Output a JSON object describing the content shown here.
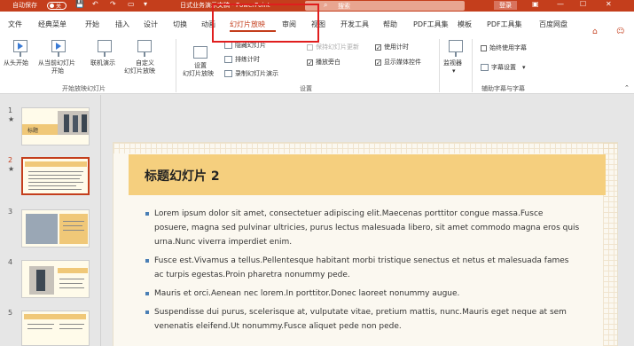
{
  "titlebar": {
    "autosave_label": "自动保存",
    "autosave_state": "关",
    "document_title": "日式业务演示文稿 - PowerPoint",
    "search_placeholder": "搜索",
    "login_label": "登录"
  },
  "tabs": [
    "文件",
    "经典菜单",
    "开始",
    "插入",
    "设计",
    "切换",
    "动画",
    "幻灯片放映",
    "审阅",
    "视图",
    "开发工具",
    "帮助",
    "PDF工具集",
    "模板",
    "PDF工具集",
    "百度网盘"
  ],
  "active_tab": "幻灯片放映",
  "ribbon": {
    "from_start": "从头开始",
    "from_current_l1": "从当前幻灯片",
    "from_current_l2": "开始",
    "online_present_l1": "联机演示",
    "online_present_l2": "",
    "custom_show_l1": "自定义",
    "custom_show_l2": "幻灯片放映",
    "group_start": "开始放映幻灯片",
    "setup_show_l1": "设置",
    "setup_show_l2": "幻灯片放映",
    "hide_slide": "隐藏幻灯片",
    "rehearse": "排练计时",
    "record": "录制幻灯片演示",
    "play_narrations": "播放旁白",
    "use_timings": "使用计时",
    "keep_updated": "保持幻灯片更新",
    "show_media_controls": "显示媒体控件",
    "group_setup": "设置",
    "monitor_l1": "监视器",
    "always_subtitles": "始终使用字幕",
    "subtitle_settings": "字幕设置",
    "group_captions": "辅助字幕与字幕"
  },
  "thumbnails": [
    {
      "num": "1",
      "star": "★"
    },
    {
      "num": "2",
      "star": "★"
    },
    {
      "num": "3",
      "star": ""
    },
    {
      "num": "4",
      "star": ""
    },
    {
      "num": "5",
      "star": ""
    }
  ],
  "thumb1_title": "标题",
  "slide": {
    "title": "标题幻灯片 2",
    "bullets": [
      "Lorem ipsum dolor sit amet, consectetuer adipiscing elit.Maecenas porttitor congue massa.Fusce posuere, magna sed pulvinar ultricies, purus lectus malesuada libero, sit amet commodo magna eros quis urna.Nunc viverra imperdiet enim.",
      "Fusce est.Vivamus a tellus.Pellentesque habitant morbi tristique senectus et netus et malesuada fames ac turpis egestas.Proin pharetra nonummy pede.",
      "Mauris et orci.Aenean nec lorem.In porttitor.Donec laoreet nonummy augue.",
      "Suspendisse dui purus, scelerisque at, vulputate vitae, pretium mattis, nunc.Mauris eget neque at sem venenatis eleifend.Ut nonummy.Fusce aliquet pede non pede."
    ]
  },
  "colors": {
    "accent": "#c43e1c",
    "title_band": "#f5cf7e",
    "highlight_box": "#e01e1e"
  }
}
